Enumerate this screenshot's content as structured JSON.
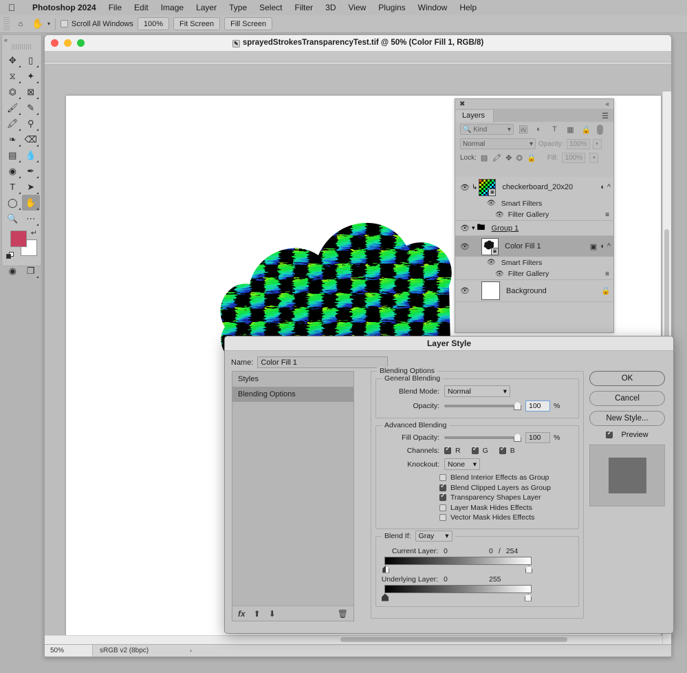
{
  "menubar": {
    "apple_icon": "apple-logo",
    "app_name": "Photoshop 2024",
    "items": [
      "File",
      "Edit",
      "Image",
      "Layer",
      "Type",
      "Select",
      "Filter",
      "3D",
      "View",
      "Plugins",
      "Window",
      "Help"
    ]
  },
  "options_bar": {
    "home_icon": "home-icon",
    "tool_icon": "hand-tool-icon",
    "scroll_all_windows_label": "Scroll All Windows",
    "scroll_all_windows_checked": false,
    "buttons": [
      "100%",
      "Fit Screen",
      "Fill Screen"
    ]
  },
  "toolbar": {
    "tools": [
      {
        "name": "move-tool",
        "glyph": "✥"
      },
      {
        "name": "marquee-tool",
        "glyph": "▭"
      },
      {
        "name": "lasso-tool",
        "glyph": "𝒫"
      },
      {
        "name": "quick-select-tool",
        "glyph": "✨"
      },
      {
        "name": "crop-tool",
        "glyph": "⌗"
      },
      {
        "name": "frame-tool",
        "glyph": "⊠"
      },
      {
        "name": "eyedropper-tool",
        "glyph": "✎"
      },
      {
        "name": "healing-brush-tool",
        "glyph": "🖊"
      },
      {
        "name": "brush-tool",
        "glyph": "🖌"
      },
      {
        "name": "clone-stamp-tool",
        "glyph": "⚲"
      },
      {
        "name": "history-brush-tool",
        "glyph": "❧"
      },
      {
        "name": "eraser-tool",
        "glyph": "⌫"
      },
      {
        "name": "gradient-tool",
        "glyph": "▤"
      },
      {
        "name": "blur-tool",
        "glyph": "💧"
      },
      {
        "name": "dodge-tool",
        "glyph": "◉"
      },
      {
        "name": "pen-tool",
        "glyph": "✒"
      },
      {
        "name": "type-tool",
        "glyph": "T"
      },
      {
        "name": "path-selection-tool",
        "glyph": "➤"
      },
      {
        "name": "ellipse-tool",
        "glyph": "◯"
      },
      {
        "name": "hand-tool",
        "glyph": "✋"
      },
      {
        "name": "zoom-tool",
        "glyph": "🔍"
      },
      {
        "name": "edit-toolbar-tool",
        "glyph": "⋯"
      }
    ],
    "selected_tool": "hand-tool",
    "foreground_color": "#c8405f",
    "background_color": "#ffffff",
    "quick_mask_icon": "quick-mask-icon",
    "screen_mode_icon": "screen-mode-icon"
  },
  "document": {
    "title": "sprayedStrokesTransparencyTest.tif @ 50% (Color Fill 1, RGB/8)",
    "status_zoom": "50%",
    "status_profile": "sRGB v2 (8bpc)"
  },
  "layers_panel": {
    "tab_label": "Layers",
    "close_icon": "close-icon",
    "collapse_icon": "collapse-icon",
    "menu_icon": "panel-menu-icon",
    "filter": {
      "kind_label": "Kind",
      "search_icon": "search-icon",
      "filter_icons": [
        "pixel-filter-icon",
        "adjustment-filter-icon",
        "type-filter-icon",
        "shape-filter-icon",
        "smart-object-filter-icon"
      ],
      "toggle_icon": "filter-toggle-icon"
    },
    "blend_mode": "Normal",
    "opacity_label": "Opacity:",
    "opacity_value": "100%",
    "lock_label": "Lock:",
    "lock_icons": [
      "lock-transparency-icon",
      "lock-image-icon",
      "lock-position-icon",
      "lock-artboard-icon",
      "lock-all-icon"
    ],
    "fill_label": "Fill:",
    "fill_value": "100%",
    "rows": [
      {
        "type": "layer",
        "name": "checkerboard_20x20",
        "visible": true,
        "selected": false,
        "thumb": "rainbow-checker-thumb",
        "clipped": true,
        "smart_object": true,
        "right_icons": [
          "smart-filter-icon",
          "expand-icon"
        ],
        "children": [
          {
            "label": "Smart Filters",
            "indent": 1,
            "visible": true,
            "options_icon": false
          },
          {
            "label": "Filter Gallery",
            "indent": 2,
            "visible": true,
            "options_icon": true
          }
        ]
      },
      {
        "type": "group",
        "name": "Group 1",
        "visible": true,
        "selected": false,
        "expanded": true
      },
      {
        "type": "layer",
        "name": "Color Fill 1",
        "visible": true,
        "selected": true,
        "thumb": "color-fill-mask-thumb",
        "smart_object": true,
        "right_icons": [
          "mask-link-icon",
          "smart-filter-icon",
          "expand-icon"
        ],
        "children": [
          {
            "label": "Smart Filters",
            "indent": 1,
            "visible": true,
            "options_icon": false
          },
          {
            "label": "Filter Gallery",
            "indent": 2,
            "visible": true,
            "options_icon": true
          }
        ]
      },
      {
        "type": "layer",
        "name": "Background",
        "visible": true,
        "selected": false,
        "thumb": "white-thumb",
        "locked": true,
        "right_icons": [
          "lock-icon"
        ]
      }
    ]
  },
  "layer_style_dialog": {
    "title": "Layer Style",
    "name_label": "Name:",
    "name_value": "Color Fill 1",
    "styles_list": [
      {
        "label": "Styles",
        "selected": false
      },
      {
        "label": "Blending Options",
        "selected": true
      }
    ],
    "list_footer_icons": [
      "fx-icon",
      "move-up-icon",
      "move-down-icon",
      "delete-icon"
    ],
    "blending_options_label": "Blending Options",
    "general_blending": {
      "label": "General Blending",
      "blend_mode_label": "Blend Mode:",
      "blend_mode_value": "Normal",
      "opacity_label": "Opacity:",
      "opacity_value": "100",
      "opacity_unit": "%"
    },
    "advanced_blending": {
      "label": "Advanced Blending",
      "fill_opacity_label": "Fill Opacity:",
      "fill_opacity_value": "100",
      "fill_opacity_unit": "%",
      "channels_label": "Channels:",
      "channels": [
        {
          "label": "R",
          "checked": true
        },
        {
          "label": "G",
          "checked": true
        },
        {
          "label": "B",
          "checked": true
        }
      ],
      "knockout_label": "Knockout:",
      "knockout_value": "None",
      "checkboxes": [
        {
          "label": "Blend Interior Effects as Group",
          "checked": false
        },
        {
          "label": "Blend Clipped Layers as Group",
          "checked": true
        },
        {
          "label": "Transparency Shapes Layer",
          "checked": true
        },
        {
          "label": "Layer Mask Hides Effects",
          "checked": false
        },
        {
          "label": "Vector Mask Hides Effects",
          "checked": false
        }
      ]
    },
    "blend_if": {
      "label": "Blend If:",
      "channel_value": "Gray",
      "current_layer_label": "Current Layer:",
      "current_layer_black": "0",
      "current_layer_white_left": "0",
      "current_layer_sep": "/",
      "current_layer_white_right": "254",
      "underlying_layer_label": "Underlying Layer:",
      "underlying_layer_black": "0",
      "underlying_layer_white": "255"
    },
    "buttons": [
      {
        "label": "OK",
        "primary": true
      },
      {
        "label": "Cancel",
        "primary": false
      },
      {
        "label": "New Style...",
        "primary": false
      }
    ],
    "preview_label": "Preview",
    "preview_checked": true
  }
}
